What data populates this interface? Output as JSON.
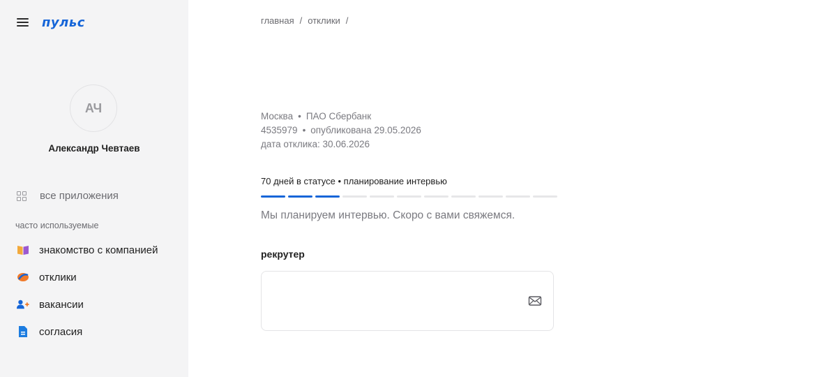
{
  "app": {
    "logo_text": "пульс"
  },
  "user": {
    "initials": "АЧ",
    "name": "Александр Чевтаев"
  },
  "sidebar": {
    "all_apps_label": "все приложения",
    "frequent_title": "часто используемые",
    "items": [
      {
        "label": "знакомство с компанией",
        "icon": "book-icon",
        "color": "#f2a93b"
      },
      {
        "label": "отклики",
        "icon": "responses-icon",
        "color": "#f07a2a"
      },
      {
        "label": "вакансии",
        "icon": "add-person-icon",
        "color": "#1565d8"
      },
      {
        "label": "согласия",
        "icon": "document-icon",
        "color": "#1c7ce0"
      }
    ]
  },
  "breadcrumb": {
    "items": [
      "главная",
      "отклики"
    ],
    "separator": "/"
  },
  "vacancy": {
    "city": "Москва",
    "company": "ПАО Сбербанк",
    "id": "4535979",
    "published": "опубликована 29.05.2026",
    "response_date": "дата отклика: 30.06.2026"
  },
  "status": {
    "text": "70 дней в статусе • планирование интервью",
    "steps_total": 11,
    "steps_done": 3,
    "description": "Мы планируем интервью. Скоро с вами свяжемся.",
    "accent": "#1565d8"
  },
  "recruiter": {
    "title": "рекрутер",
    "mail_icon": "mail-icon"
  }
}
